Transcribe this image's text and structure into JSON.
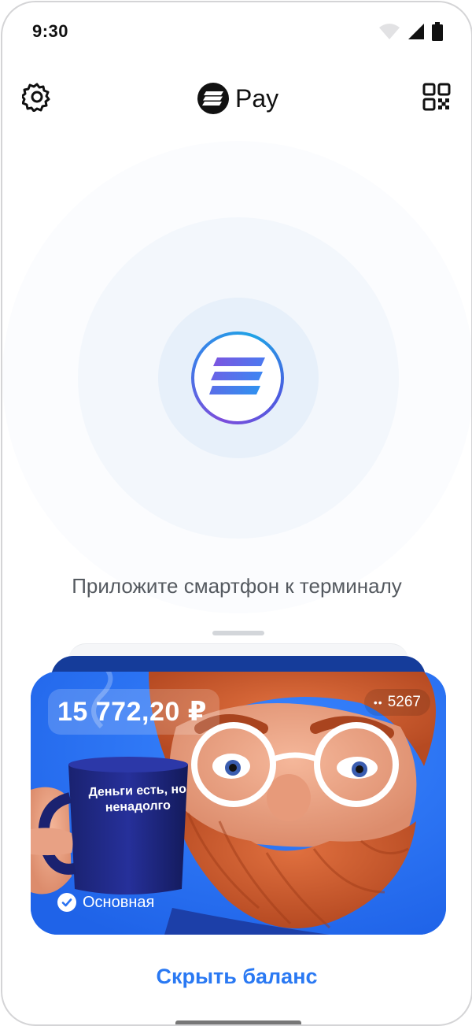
{
  "status_bar": {
    "time": "9:30",
    "icons": [
      "wifi-icon",
      "cellular-signal-icon",
      "battery-icon"
    ]
  },
  "header": {
    "brand_name": "Pay",
    "settings_icon": "gear-icon",
    "qr_icon": "qr-code-icon"
  },
  "nfc": {
    "hint": "Приложите смартфон к терминалу"
  },
  "card": {
    "balance": "15 772,20 ₽",
    "pan_mask": "••",
    "pan_last4": "5267",
    "mug_text": "Деньги есть, но ненадолго",
    "main_label": "Основная"
  },
  "actions": {
    "hide_balance": "Скрыть баланс"
  },
  "colors": {
    "accent": "#2a79f3",
    "card_background": "#2a72f2",
    "card_back": "#153c9a"
  }
}
